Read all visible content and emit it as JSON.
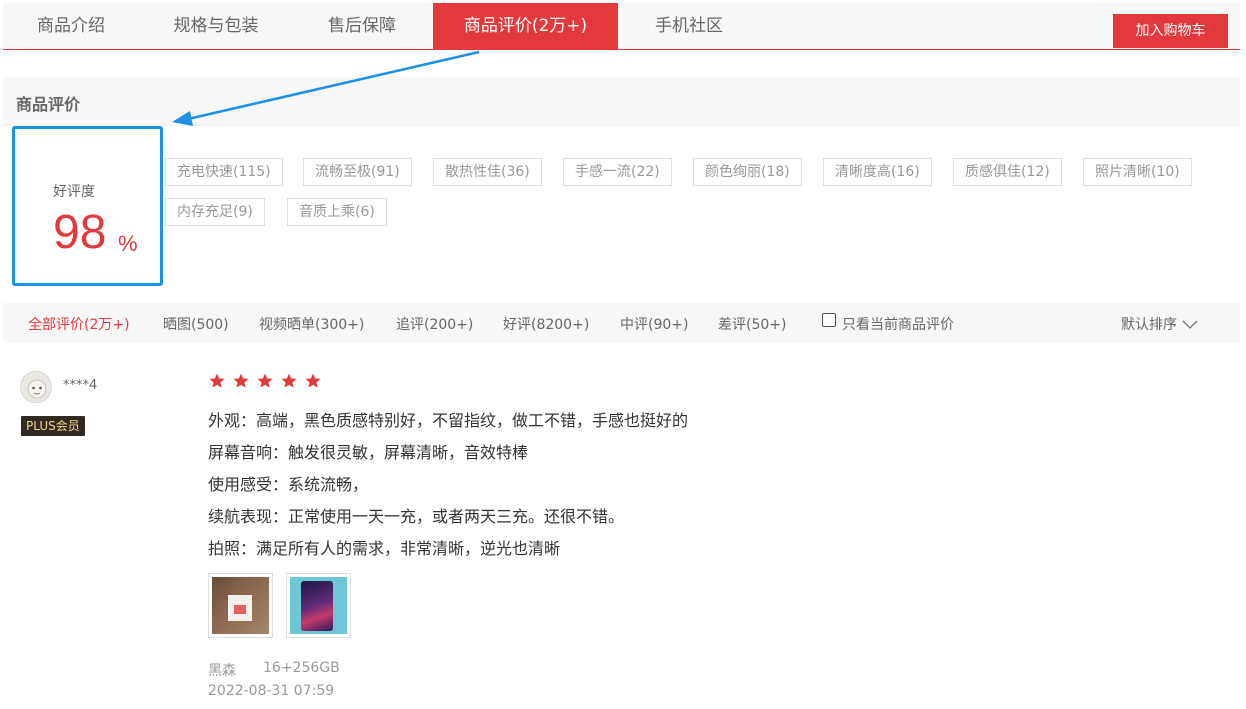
{
  "nav": {
    "tabs": [
      {
        "label": "商品介绍"
      },
      {
        "label": "规格与包装"
      },
      {
        "label": "售后保障"
      },
      {
        "label": "商品评价(2万+)"
      },
      {
        "label": "手机社区"
      }
    ],
    "active_tab": "商品评价(2万+)",
    "cart_button": "加入购物车"
  },
  "section": {
    "title": "商品评价"
  },
  "rating": {
    "label": "好评度",
    "value": "98",
    "unit": "%"
  },
  "tags": [
    "充电快速(115)",
    "流畅至极(91)",
    "散热性佳(36)",
    "手感一流(22)",
    "颜色绚丽(18)",
    "清晰度高(16)",
    "质感俱佳(12)",
    "照片清晰(10)",
    "内存充足(9)",
    "音质上乘(6)"
  ],
  "filters": {
    "items": [
      "全部评价(2万+)",
      "晒图(500)",
      "视频晒单(300+)",
      "追评(200+)",
      "好评(8200+)",
      "中评(90+)",
      "差评(50+)"
    ],
    "active": "全部评价(2万+)",
    "only_current_label": "只看当前商品评价",
    "only_current_checked": false,
    "sort_label": "默认排序"
  },
  "review": {
    "username": "****4",
    "badge": "PLUS会员",
    "stars": 5,
    "lines": [
      "外观：高端，黑色质感特别好，不留指纹，做工不错，手感也挺好的",
      "屏幕音响：触发很灵敏，屏幕清晰，音效特棒",
      "使用感受：系统流畅，",
      "续航表现：正常使用一天一充，或者两天三充。还很不错。",
      "拍照：满足所有人的需求，非常清晰，逆光也清晰"
    ],
    "color": "黑森",
    "spec": "16+256GB",
    "date": "2022-08-31 07:59"
  },
  "colors": {
    "accent": "#e4393c",
    "highlight_box": "#1e90e6",
    "star": "#e4393c"
  }
}
